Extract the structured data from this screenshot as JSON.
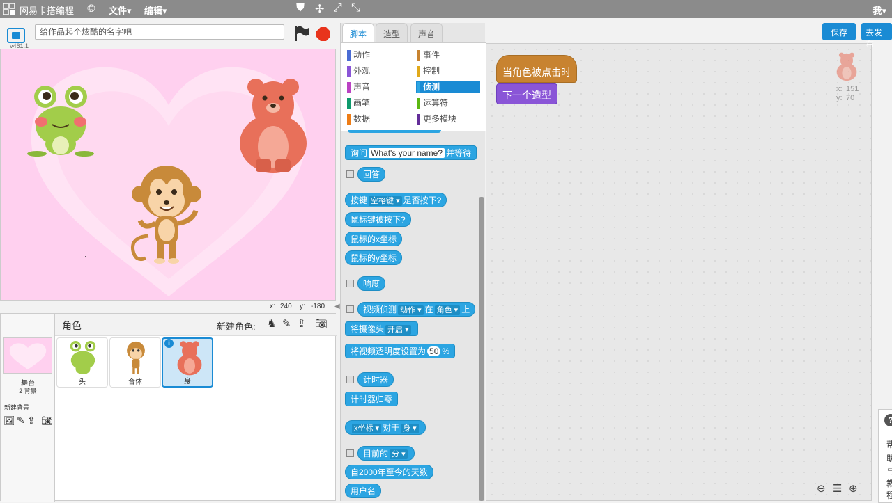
{
  "menubar": {
    "title": "网易卡搭编程",
    "menus": [
      "文件▾",
      "编辑▾"
    ],
    "user": "我▾"
  },
  "stage": {
    "version": "v461.1",
    "title_placeholder": "给作品起个炫酷的名字吧",
    "mouse_x_label": "x:",
    "mouse_x": "240",
    "mouse_y_label": "y:",
    "mouse_y": "-180"
  },
  "sprite_panel": {
    "header": "角色",
    "new_sprite_label": "新建角色:",
    "stage_label": "舞台",
    "stage_backdrops": "2 背景",
    "new_backdrop_label": "新建背景",
    "sprites": [
      {
        "name": "头",
        "selected": false
      },
      {
        "name": "合体",
        "selected": false
      },
      {
        "name": "身",
        "selected": true
      }
    ]
  },
  "palette": {
    "tabs": [
      "脚本",
      "造型",
      "声音"
    ],
    "categories": [
      {
        "label": "动作",
        "color": "#4a6cd4"
      },
      {
        "label": "事件",
        "color": "#c88330"
      },
      {
        "label": "外观",
        "color": "#8a55d7"
      },
      {
        "label": "控制",
        "color": "#e1a91a"
      },
      {
        "label": "声音",
        "color": "#bb42c3"
      },
      {
        "label": "侦测",
        "color": "#2ca5e2"
      },
      {
        "label": "画笔",
        "color": "#0e9a6c"
      },
      {
        "label": "运算符",
        "color": "#5cb712"
      },
      {
        "label": "数据",
        "color": "#ee7d16"
      },
      {
        "label": "更多模块",
        "color": "#632d99"
      }
    ],
    "blocks": {
      "ask": "询问",
      "ask_default": "What's your name?",
      "ask_wait": "并等待",
      "answer": "回答",
      "key_pressed_pre": "按键",
      "key_pressed_key": "空格键",
      "key_pressed_post": "是否按下?",
      "mouse_down": "鼠标键被按下?",
      "mouse_x": "鼠标的x坐标",
      "mouse_y": "鼠标的y坐标",
      "loudness": "响度",
      "video_motion": "视频侦测",
      "video_motion_dd": "动作",
      "video_on": "在",
      "video_target": "角色",
      "video_on_suffix": "上",
      "camera": "将摄像头",
      "camera_dd": "开启",
      "video_transparency": "将视频透明度设置为",
      "video_transparency_val": "50",
      "video_transparency_unit": "%",
      "timer": "计时器",
      "reset_timer": "计时器归零",
      "of_attr": "x坐标",
      "of_word": "对于",
      "of_target": "身",
      "current": "目前的",
      "current_dd": "分",
      "days_since": "自2000年至今的天数",
      "username": "用户名"
    }
  },
  "scripts": {
    "hat": "当角色被点击时",
    "next_costume": "下一个造型",
    "sprite_x_label": "x:",
    "sprite_x": "151",
    "sprite_y_label": "y:",
    "sprite_y": "70"
  },
  "buttons": {
    "save": "保存",
    "publish": "去发布"
  },
  "help_panel": {
    "icon": "?",
    "chars": [
      "帮",
      "助",
      "与",
      "教",
      "程"
    ]
  }
}
